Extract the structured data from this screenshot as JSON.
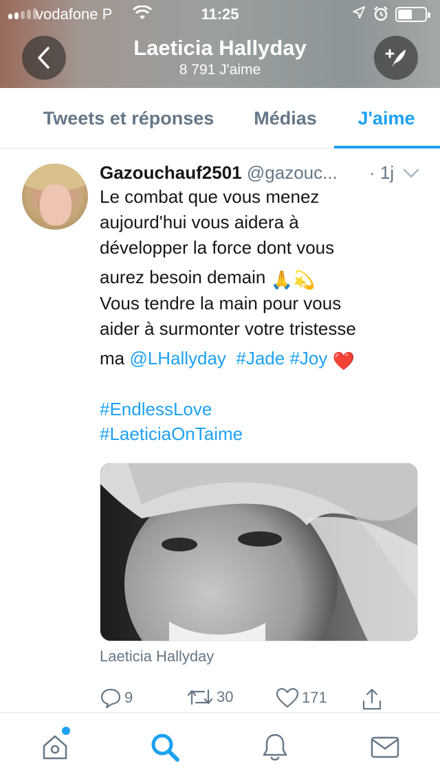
{
  "status_bar": {
    "carrier": "vodafone P",
    "time": "11:25"
  },
  "header": {
    "title": "Laeticia Hallyday",
    "subtitle": "8 791 J'aime"
  },
  "tabs": [
    {
      "label": "Tweets et réponses",
      "active": false
    },
    {
      "label": "Médias",
      "active": false
    },
    {
      "label": "J'aime",
      "active": true
    }
  ],
  "tweet": {
    "name": "Gazouchauf2501",
    "handle": "@gazouc...",
    "time": "· 1j",
    "lines": {
      "l1": "Le combat que vous menez",
      "l2": "aujourd'hui vous aidera à",
      "l3": "développer la force dont vous",
      "l4": "aurez besoin demain",
      "l4_emoji": "🙏💫",
      "l5": "Vous tendre la main pour vous",
      "l6": "aider à surmonter votre tristesse",
      "l7_prefix": "ma",
      "l7_mention": "@LHallyday",
      "l7_tag1": "#Jade",
      "l7_tag2": "#Joy",
      "l7_emoji": "❤️",
      "tag_a": "#EndlessLove",
      "tag_b": "#LaeticiaOnTaime"
    },
    "media_caption": "Laeticia Hallyday",
    "stats": {
      "replies": "9",
      "retweets": "30",
      "likes": "171"
    }
  },
  "colors": {
    "accent": "#1da1f2",
    "muted": "#657786",
    "text": "#14171a"
  },
  "icons": {
    "back": "chevron-left-icon",
    "compose": "compose-icon",
    "home": "home-icon",
    "search": "search-icon",
    "notifications": "bell-icon",
    "messages": "mail-icon"
  }
}
